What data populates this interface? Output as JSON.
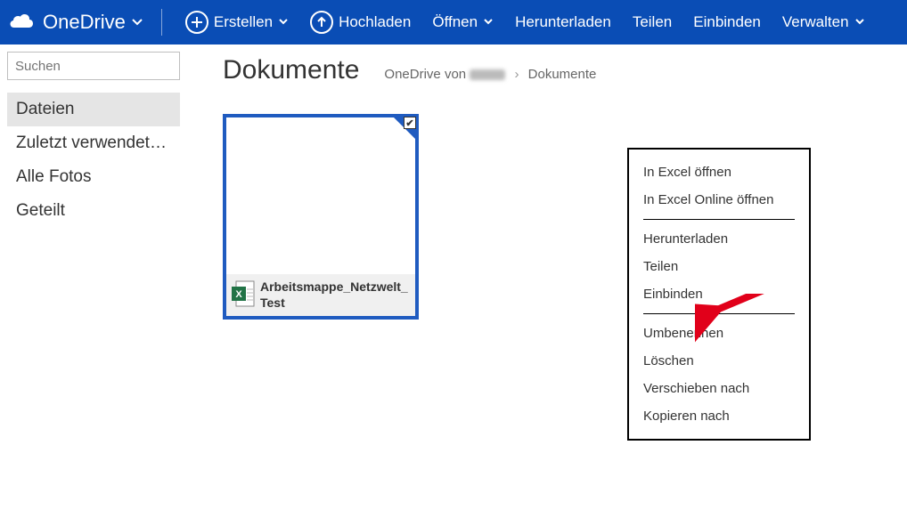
{
  "brand": {
    "name": "OneDrive"
  },
  "topbar": {
    "create": "Erstellen",
    "upload": "Hochladen",
    "open": "Öffnen",
    "download": "Herunterladen",
    "share": "Teilen",
    "embed": "Einbinden",
    "manage": "Verwalten"
  },
  "search": {
    "placeholder": "Suchen"
  },
  "sidebar": {
    "items": [
      "Dateien",
      "Zuletzt verwendete Dokumente",
      "Alle Fotos",
      "Geteilt"
    ]
  },
  "page": {
    "title": "Dokumente",
    "breadcrumb_prefix": "OneDrive von",
    "breadcrumb_current": "Dokumente"
  },
  "file": {
    "name": "Arbeitsmappe_Netzwelt_Test"
  },
  "contextmenu": {
    "open_excel": "In Excel öffnen",
    "open_excel_online": "In Excel Online öffnen",
    "download": "Herunterladen",
    "share": "Teilen",
    "embed": "Einbinden",
    "rename": "Umbenennen",
    "delete": "Löschen",
    "move": "Verschieben nach",
    "copy": "Kopieren nach"
  }
}
